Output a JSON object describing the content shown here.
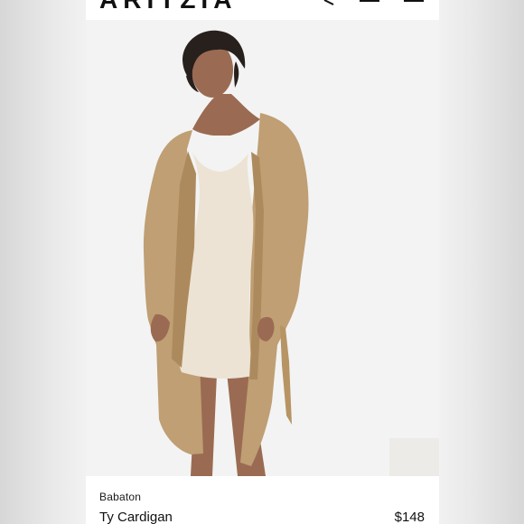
{
  "header": {
    "logo_text": "ARITZIA",
    "icons": [
      "search-icon",
      "bag-icon",
      "menu-icon"
    ]
  },
  "product": {
    "image_alt": "Model wearing a long camel open-front cardigan over a cream ribbed mini dress",
    "brand": "Babaton",
    "name": "Ty Cardigan",
    "price": "$148"
  },
  "colors": {
    "cardigan": "#bf9f73",
    "dress": "#ece3d4",
    "background": "#f3f3f3",
    "text": "#111111"
  }
}
